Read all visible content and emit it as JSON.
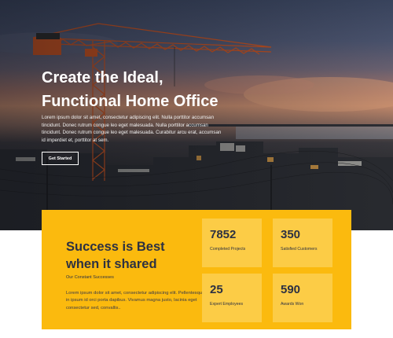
{
  "hero": {
    "title_line1": "Create the Ideal,",
    "title_line2": "Functional Home Office",
    "description": "Lorem ipsum dolor sit amet, consectetur adipiscing elit. Nulla porttitor accumsan tincidunt. Donec rutrum congue leo eget malesuada. Nulla porttitor accumsan tincidunt. Donec rutrum congue leo eget malesuada. Curabitur arcu erat, accumsan id imperdiet et, porttitor at sem.",
    "button_label": "Get Started"
  },
  "panel": {
    "heading": "Success is Best when it shared",
    "subheading": "Our Constant Successes",
    "body": "Lorem ipsum dolor sit amet, consectetur adipiscing elit. Pellentesque in ipsum id orci porta dapibus. Vivamus magna justo, lacinia eget consectetur sed, convallis..",
    "stats": [
      {
        "value": "7852",
        "label": "Completed Projects"
      },
      {
        "value": "350",
        "label": "Satisfied Customers"
      },
      {
        "value": "25",
        "label": "Expert Employees"
      },
      {
        "value": "590",
        "label": "Awards Won"
      }
    ]
  },
  "colors": {
    "accent_yellow": "#fbba0e",
    "stat_box": "#fccc46",
    "heading_text": "#2d3142"
  }
}
